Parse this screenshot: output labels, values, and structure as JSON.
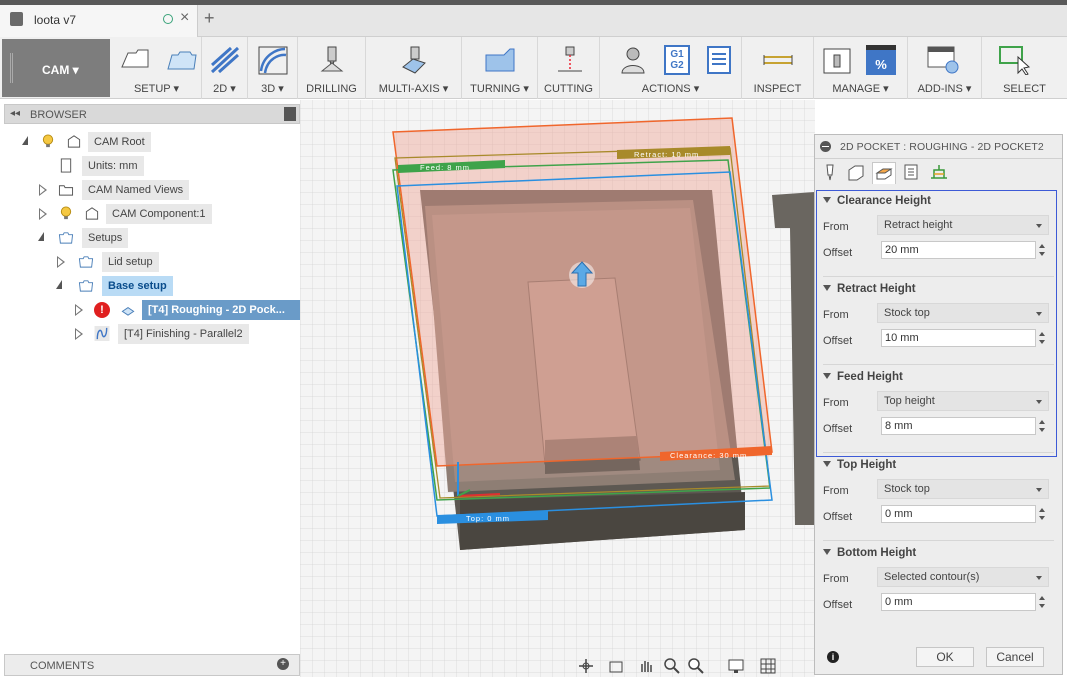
{
  "document": {
    "title": "loota v7"
  },
  "toolbar": {
    "workspace": "CAM",
    "groups": [
      {
        "label": "SETUP"
      },
      {
        "label": "2D"
      },
      {
        "label": "3D"
      },
      {
        "label": "DRILLING"
      },
      {
        "label": "MULTI-AXIS"
      },
      {
        "label": "TURNING"
      },
      {
        "label": "CUTTING"
      },
      {
        "label": "ACTIONS"
      },
      {
        "label": "INSPECT"
      },
      {
        "label": "MANAGE"
      },
      {
        "label": "ADD-INS"
      },
      {
        "label": "SELECT"
      }
    ],
    "actions_icon_text": [
      "G1",
      "G2"
    ],
    "manage_icon_text": "%"
  },
  "browser": {
    "title": "BROWSER",
    "items": [
      {
        "label": "CAM Root"
      },
      {
        "label": "Units: mm"
      },
      {
        "label": "CAM Named Views"
      },
      {
        "label": "CAM Component:1"
      },
      {
        "label": "Setups"
      },
      {
        "label": "Lid setup"
      },
      {
        "label": "Base setup"
      },
      {
        "label": "[T4] Roughing - 2D Pock..."
      },
      {
        "label": "[T4] Finishing - Parallel2"
      }
    ]
  },
  "comments": {
    "title": "COMMENTS"
  },
  "viewport": {
    "planes": [
      {
        "label": "Feed: 8 mm",
        "color": "#3fa34a"
      },
      {
        "label": "Retract: 10 mm",
        "color": "#a88a2a"
      },
      {
        "label": "Clearance: 30 mm",
        "color": "#f0662c"
      },
      {
        "label": "Top: 0 mm",
        "color": "#2a8fe0"
      }
    ]
  },
  "dialog": {
    "title": "2D POCKET : ROUGHING - 2D POCKET2",
    "sections": [
      {
        "title": "Clearance Height",
        "from_label": "From",
        "from_value": "Retract height",
        "offset_label": "Offset",
        "offset_value": "20 mm"
      },
      {
        "title": "Retract Height",
        "from_label": "From",
        "from_value": "Stock top",
        "offset_label": "Offset",
        "offset_value": "10 mm"
      },
      {
        "title": "Feed Height",
        "from_label": "From",
        "from_value": "Top height",
        "offset_label": "Offset",
        "offset_value": "8 mm"
      },
      {
        "title": "Top Height",
        "from_label": "From",
        "from_value": "Stock top",
        "offset_label": "Offset",
        "offset_value": "0 mm"
      },
      {
        "title": "Bottom Height",
        "from_label": "From",
        "from_value": "Selected contour(s)",
        "offset_label": "Offset",
        "offset_value": "0 mm"
      }
    ],
    "ok_label": "OK",
    "cancel_label": "Cancel"
  }
}
